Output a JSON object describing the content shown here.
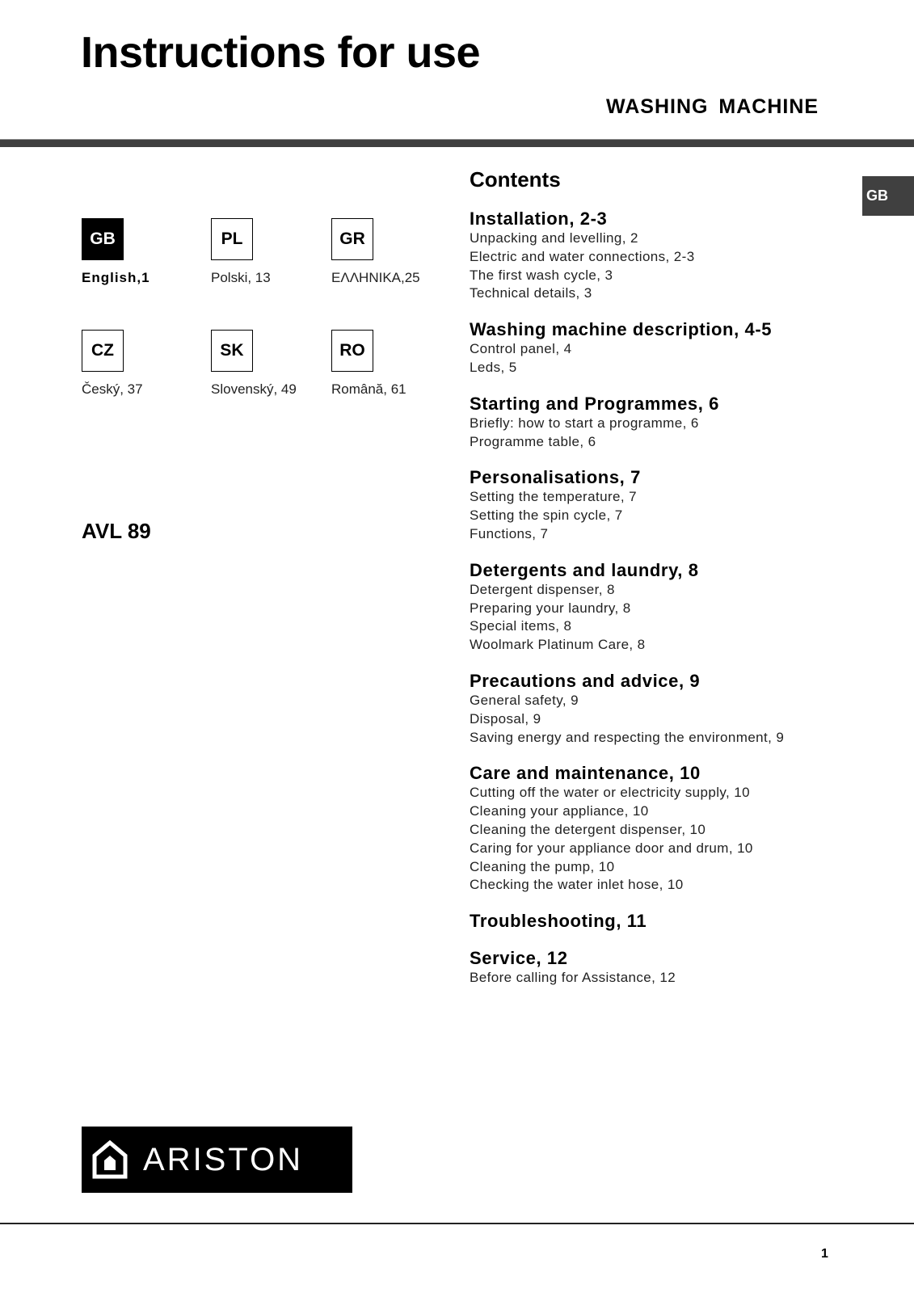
{
  "header": {
    "title": "Instructions for use",
    "subtitle": "WASHING MACHINE",
    "side_tab": "GB"
  },
  "languages": [
    {
      "code": "GB",
      "label": "English,1",
      "active": true
    },
    {
      "code": "PL",
      "label": "Polski, 13",
      "active": false
    },
    {
      "code": "GR",
      "label": "ΕΛΛΗΝΙΚΑ,25",
      "active": false
    },
    {
      "code": "CZ",
      "label": "Český, 37",
      "active": false
    },
    {
      "code": "SK",
      "label": "Slovenský, 49",
      "active": false
    },
    {
      "code": "RO",
      "label": "Română, 61",
      "active": false
    }
  ],
  "model": "AVL 89",
  "contents": {
    "title": "Contents",
    "sections": [
      {
        "heading": "Installation, 2-3",
        "items": [
          "Unpacking and levelling, 2",
          "Electric and water connections, 2-3",
          "The first wash cycle, 3",
          "Technical details, 3"
        ]
      },
      {
        "heading": "Washing machine description, 4-5",
        "items": [
          "Control panel, 4",
          "Leds, 5"
        ]
      },
      {
        "heading": "Starting and Programmes, 6",
        "items": [
          "Briefly: how to start a programme, 6",
          "Programme table, 6"
        ]
      },
      {
        "heading": "Personalisations, 7",
        "items": [
          "Setting the temperature, 7",
          "Setting the spin cycle, 7",
          "Functions, 7"
        ]
      },
      {
        "heading": "Detergents and laundry, 8",
        "items": [
          "Detergent dispenser, 8",
          "Preparing your laundry, 8",
          "Special items, 8",
          "Woolmark Platinum Care, 8"
        ]
      },
      {
        "heading": "Precautions and advice, 9",
        "items": [
          "General safety, 9",
          "Disposal, 9",
          "Saving energy and respecting the environment, 9"
        ]
      },
      {
        "heading": "Care and maintenance, 10",
        "items": [
          "Cutting off the water or electricity supply, 10",
          "Cleaning your appliance, 10",
          "Cleaning the detergent dispenser, 10",
          "Caring for your appliance door and drum, 10",
          "Cleaning the pump, 10",
          "Checking the water inlet hose, 10"
        ]
      },
      {
        "heading": "Troubleshooting, 11",
        "items": []
      },
      {
        "heading": "Service, 12",
        "items": [
          "Before calling for Assistance, 12"
        ]
      }
    ]
  },
  "brand": {
    "name": "ARISTON",
    "icon": "house-icon"
  },
  "footer": {
    "page_number": "1"
  }
}
